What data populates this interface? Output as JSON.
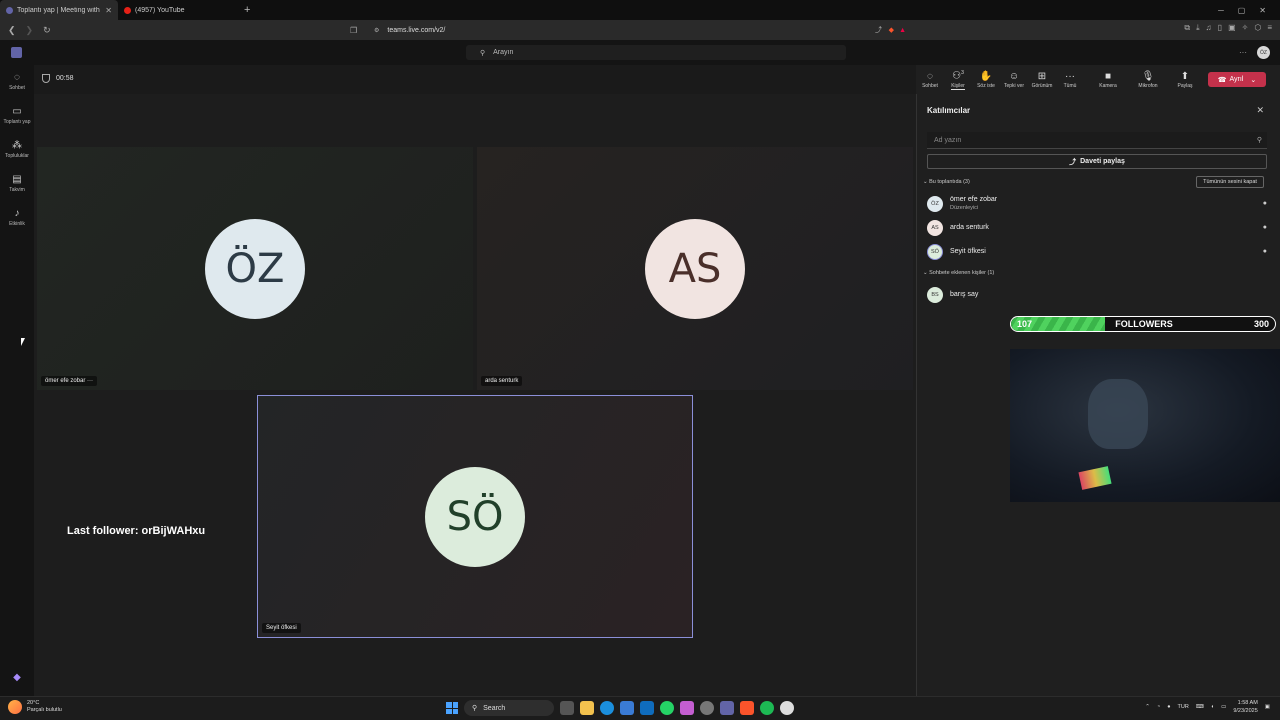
{
  "browser": {
    "tabs": [
      {
        "title": "Toplantı yap | Meeting with o",
        "active": true
      },
      {
        "title": "(4957) YouTube",
        "active": false
      }
    ],
    "url": "teams.live.com/v2/"
  },
  "teams": {
    "search_placeholder": "Arayın",
    "avatar_initials": "ÖZ",
    "rail": [
      {
        "icon": "chat-icon",
        "label": "Sohbet"
      },
      {
        "icon": "video-icon",
        "label": "Toplantı yap"
      },
      {
        "icon": "communities-icon",
        "label": "Topluluklar"
      },
      {
        "icon": "calendar-icon",
        "label": "Takvim"
      },
      {
        "icon": "bell-icon",
        "label": "Etkinlik"
      }
    ]
  },
  "meeting": {
    "timer": "00:58",
    "controls": [
      {
        "icon": "chat-icon",
        "label": "Sohbet"
      },
      {
        "icon": "people-icon",
        "label": "Kişiler",
        "badge": "3"
      },
      {
        "icon": "raise-hand-icon",
        "label": "Söz iste"
      },
      {
        "icon": "emoji-icon",
        "label": "Tepki ver"
      },
      {
        "icon": "view-icon",
        "label": "Görünüm"
      },
      {
        "icon": "more-icon",
        "label": "Tümü"
      },
      {
        "icon": "camera-icon",
        "label": "Kamera"
      },
      {
        "icon": "mic-icon",
        "label": "Mikrofon"
      },
      {
        "icon": "share-icon",
        "label": "Paylaş"
      }
    ],
    "leave_label": "Ayrıl",
    "tiles": [
      {
        "initials": "ÖZ",
        "name": "ömer efe zobar"
      },
      {
        "initials": "AS",
        "name": "arda senturk"
      },
      {
        "initials": "SÖ",
        "name": "Seyit öfkesi"
      }
    ]
  },
  "participants": {
    "title": "Katılımcılar",
    "search_placeholder": "Ad yazın",
    "invite_label": "Daveti paylaş",
    "in_meeting_label": "Bu toplantıda (3)",
    "mute_all_label": "Tümünün sesini kapat",
    "in_meeting": [
      {
        "initials": "ÖZ",
        "name": "ömer efe zobar",
        "role": "Düzenleyici"
      },
      {
        "initials": "AS",
        "name": "arda senturk",
        "role": ""
      },
      {
        "initials": "SÖ",
        "name": "Seyit öfkesi",
        "role": ""
      }
    ],
    "chat_added_label": "Sohbete eklenen kişiler (1)",
    "chat_added": [
      {
        "initials": "BS",
        "name": "barış say"
      }
    ]
  },
  "overlay": {
    "followers_current": "107",
    "followers_label": "FOLLOWERS",
    "followers_goal": "300",
    "followers_fraction": 0.357,
    "last_follower": "Last follower: orBijWAHxu"
  },
  "taskbar": {
    "temp": "20°C",
    "weather": "Parçalı bulutlu",
    "search_label": "Search",
    "lang": "TUR",
    "time": "1:58 AM",
    "date": "9/23/2025"
  },
  "colors": {
    "leave": "#c4314b",
    "tile1_avatar": "#dfe9ee",
    "tile2_avatar": "#f1e4e1",
    "tile3_avatar": "#dcecdc",
    "followers_fill": "#3ab54a"
  }
}
